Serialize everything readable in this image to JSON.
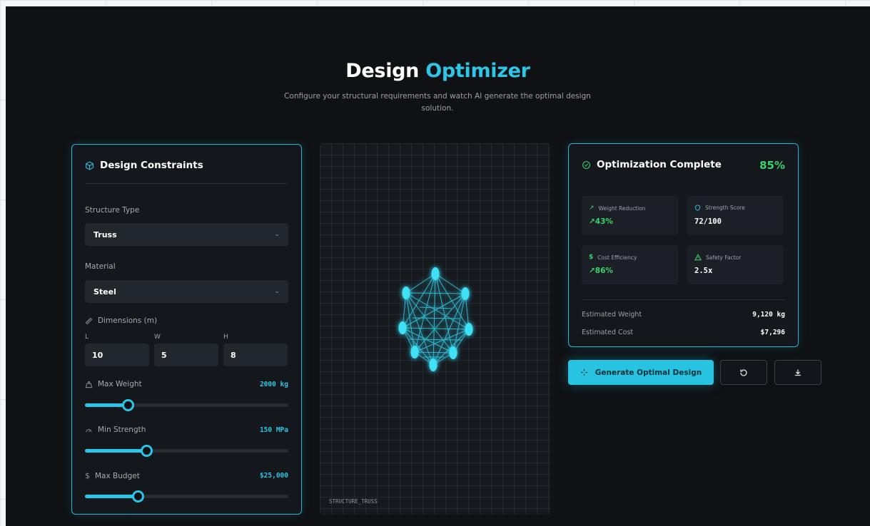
{
  "header": {
    "title_main": "Design",
    "title_accent": "Optimizer",
    "subtitle": "Configure your structural requirements and watch AI generate the optimal design solution."
  },
  "constraints": {
    "title": "Design Constraints",
    "structure_type_label": "Structure Type",
    "structure_type_value": "Truss",
    "material_label": "Material",
    "material_value": "Steel",
    "dimensions_label": "Dimensions (m)",
    "dimensions": [
      {
        "label": "L",
        "value": "10"
      },
      {
        "label": "W",
        "value": "5"
      },
      {
        "label": "H",
        "value": "8"
      }
    ],
    "sliders": [
      {
        "label": "Max Weight",
        "value": "2000 kg",
        "fraction": 0.21
      },
      {
        "label": "Min Strength",
        "value": "150 MPa",
        "fraction": 0.3
      },
      {
        "label": "Max Budget",
        "value": "$25,000",
        "fraction": 0.26
      }
    ]
  },
  "preview": {
    "label": "STRUCTURE_TRUSS"
  },
  "results": {
    "title": "Optimization Complete",
    "percent": "85%",
    "stats": [
      {
        "label": "Weight Reduction",
        "value": "↗43%",
        "icon": "trend-icon"
      },
      {
        "label": "Strength Score",
        "value": "72/100",
        "icon": "shield-icon"
      },
      {
        "label": "Cost Efficiency",
        "value": "↗86%",
        "icon": "dollar-icon"
      },
      {
        "label": "Safety Factor",
        "value": "2.5x",
        "icon": "warning-icon"
      }
    ],
    "estimated_weight_label": "Estimated Weight",
    "estimated_weight_value": "9,120 kg",
    "estimated_cost_label": "Estimated Cost",
    "estimated_cost_value": "$7,296"
  },
  "actions": {
    "generate_label": "Generate Optimal Design"
  },
  "colors": {
    "accent": "#2cc6e6",
    "success": "#3ad26b",
    "background": "#0f1114"
  }
}
